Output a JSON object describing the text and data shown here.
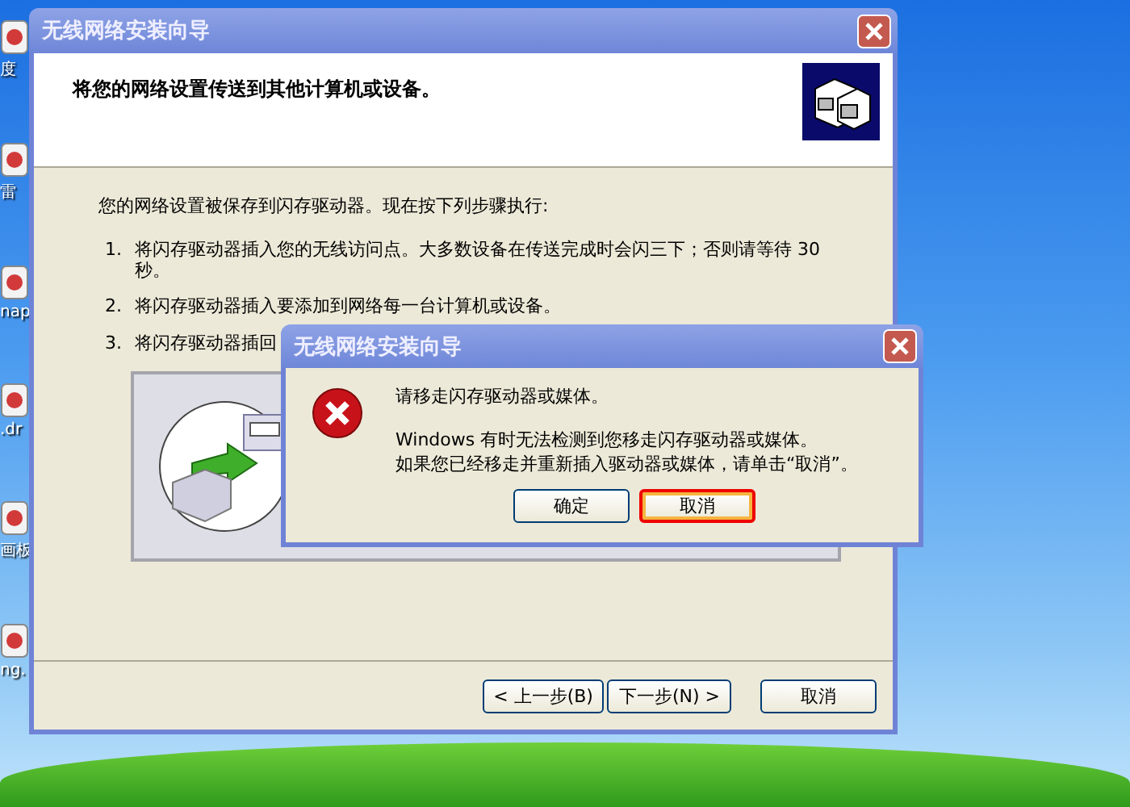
{
  "desktop": {
    "icons": [
      {
        "label": "度"
      },
      {
        "label": "雷"
      },
      {
        "label": "nap"
      },
      {
        "label": ".dr"
      },
      {
        "label": "画板"
      },
      {
        "label": "ng."
      }
    ]
  },
  "wizard": {
    "title": "无线网络安装向导",
    "heading": "将您的网络设置传送到其他计算机或设备。",
    "intro": "您的网络设置被保存到闪存驱动器。现在按下列步骤执行:",
    "steps": [
      {
        "number": "1.",
        "text": "将闪存驱动器插入您的无线访问点。大多数设备在传送完成时会闪三下；否则请等待 30 秒。"
      },
      {
        "number": "2.",
        "text": "将闪存驱动器插入要添加到网络每一台计算机或设备。"
      },
      {
        "number": "3.",
        "text": "将闪存驱动器插回"
      }
    ],
    "buttons": [
      {
        "label": "< 上一步(B)",
        "default": false
      },
      {
        "label": "下一步(N) >",
        "default": false
      },
      {
        "label": "取消",
        "default": false
      }
    ]
  },
  "dialog": {
    "title": "无线网络安装向导",
    "message": "请移走闪存驱动器或媒体。",
    "details": [
      "Windows 有时无法检测到您移走闪存驱动器或媒体。",
      "如果您已经移走并重新插入驱动器或媒体，请单击“取消”。"
    ],
    "buttons": [
      {
        "label": "确定",
        "default": false,
        "highlighted": false
      },
      {
        "label": "取消",
        "default": true,
        "highlighted": true
      }
    ]
  }
}
